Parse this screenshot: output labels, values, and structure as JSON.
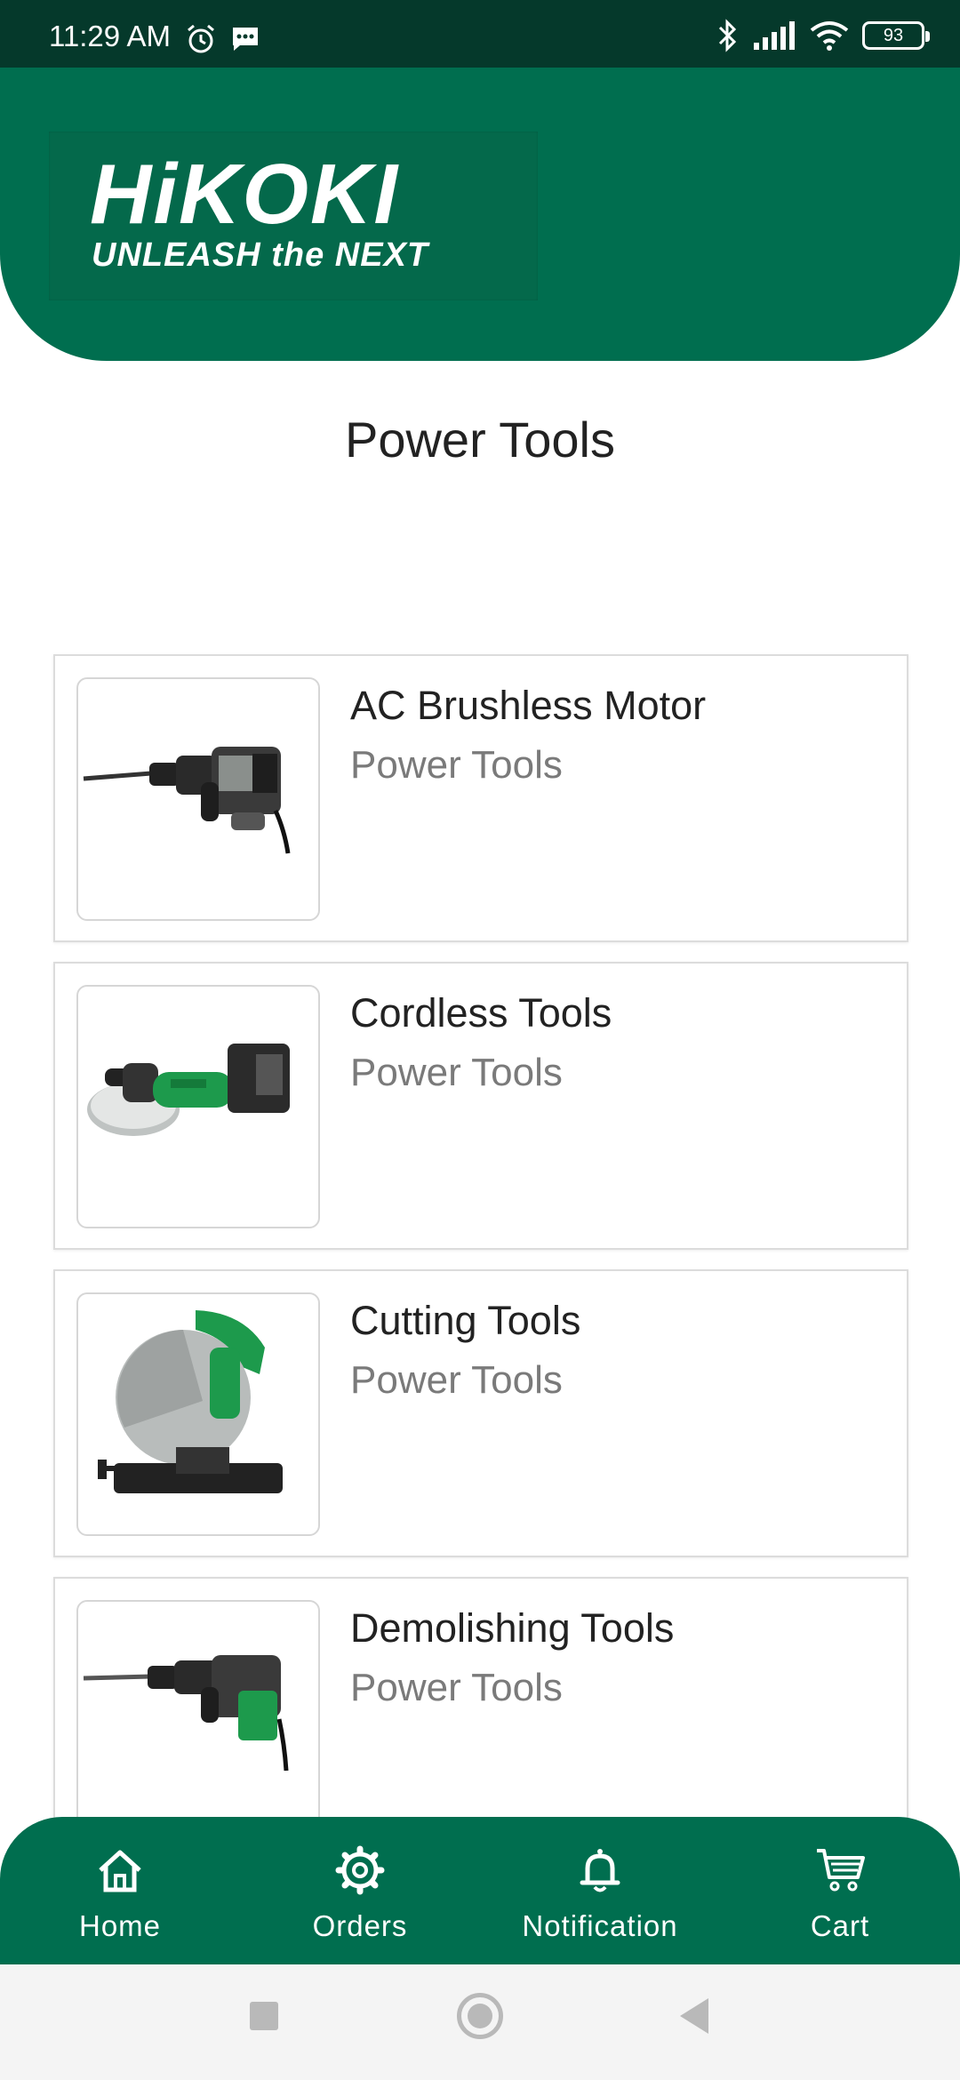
{
  "status_bar": {
    "time": "11:29 AM",
    "battery": "93",
    "icons": [
      "alarm-icon",
      "message-icon",
      "bluetooth-icon",
      "signal-icon",
      "wifi-icon",
      "battery-icon"
    ]
  },
  "header": {
    "logo_main": "HiKOKI",
    "logo_sub": "UNLEASH the NEXT",
    "brand_color": "#006e4f"
  },
  "page": {
    "title": "Power Tools"
  },
  "categories": [
    {
      "title": "AC Brushless Motor",
      "subtitle": "Power Tools",
      "image": "demolition-hammer-grey"
    },
    {
      "title": "Cordless Tools",
      "subtitle": "Power Tools",
      "image": "angle-grinder-green"
    },
    {
      "title": "Cutting Tools",
      "subtitle": "Power Tools",
      "image": "cut-off-saw"
    },
    {
      "title": "Demolishing Tools",
      "subtitle": "Power Tools",
      "image": "demolition-hammer-green"
    }
  ],
  "bottom_nav": [
    {
      "label": "Home",
      "icon": "home-icon"
    },
    {
      "label": "Orders",
      "icon": "gear-icon"
    },
    {
      "label": "Notification",
      "icon": "bell-icon"
    },
    {
      "label": "Cart",
      "icon": "cart-icon"
    }
  ]
}
